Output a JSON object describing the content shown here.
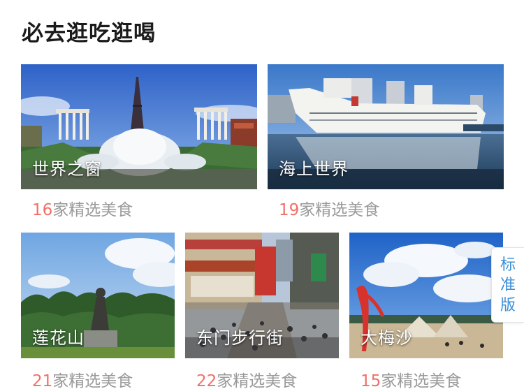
{
  "section": {
    "title": "必去逛吃逛喝"
  },
  "cards": [
    {
      "name": "世界之窗",
      "count": "16",
      "suffix": "家精选美食",
      "photo_icon": "eiffel-tower-fountain-photo"
    },
    {
      "name": "海上世界",
      "count": "19",
      "suffix": "家精选美食",
      "photo_icon": "cruise-ship-photo"
    },
    {
      "name": "莲花山",
      "count": "21",
      "suffix": "家精选美食",
      "photo_icon": "statue-park-photo"
    },
    {
      "name": "东门步行街",
      "count": "22",
      "suffix": "家精选美食",
      "photo_icon": "pedestrian-street-photo"
    },
    {
      "name": "大梅沙",
      "count": "15",
      "suffix": "家精选美食",
      "photo_icon": "beach-sculpture-photo"
    }
  ],
  "version_tab": {
    "chars": [
      "标",
      "准",
      "版"
    ]
  },
  "colors": {
    "count_accent": "#f07068",
    "secondary_text": "#9a9a9a",
    "tab_text": "#3d8fd6"
  }
}
